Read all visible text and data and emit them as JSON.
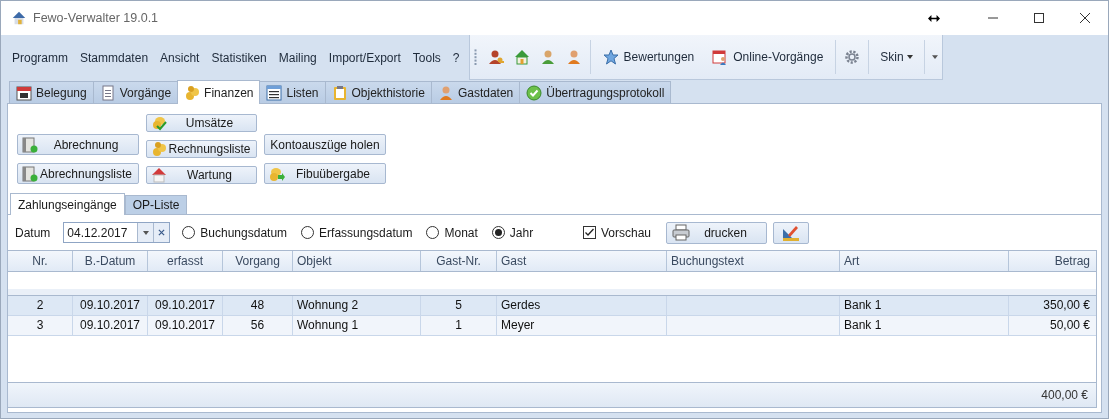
{
  "window": {
    "title": "Fewo-Verwalter 19.0.1"
  },
  "menu": [
    "Programm",
    "Stammdaten",
    "Ansicht",
    "Statistiken",
    "Mailing",
    "Import/Export",
    "Tools",
    "?"
  ],
  "toolbar": [
    {
      "kind": "icon"
    },
    {
      "kind": "icon"
    },
    {
      "kind": "icon"
    },
    {
      "kind": "icon"
    },
    {
      "kind": "button",
      "label": "Bewertungen"
    },
    {
      "kind": "button",
      "label": "Online-Vorgänge"
    },
    {
      "kind": "icon"
    },
    {
      "kind": "dropdown",
      "label": "Skin"
    }
  ],
  "module_tabs": [
    {
      "label": "Belegung",
      "selected": false
    },
    {
      "label": "Vorgänge",
      "selected": false
    },
    {
      "label": "Finanzen",
      "selected": true
    },
    {
      "label": "Listen",
      "selected": false
    },
    {
      "label": "Objekthistorie",
      "selected": false
    },
    {
      "label": "Gastdaten",
      "selected": false
    },
    {
      "label": "Übertragungsprotokoll",
      "selected": false
    }
  ],
  "action_columns": [
    [
      "Abrechnung",
      "Abrechnungsliste"
    ],
    [
      "Umsätze",
      "Rechnungsliste",
      "Wartung"
    ],
    [
      "Kontoauszüge holen",
      "Fibuübergabe"
    ]
  ],
  "sub_tabs": [
    {
      "label": "Zahlungseingänge",
      "selected": true
    },
    {
      "label": "OP-Liste",
      "selected": false
    }
  ],
  "filter": {
    "date_label": "Datum",
    "date_value": "04.12.2017",
    "radios": [
      {
        "label": "Buchungsdatum",
        "selected": false
      },
      {
        "label": "Erfassungsdatum",
        "selected": false
      },
      {
        "label": "Monat",
        "selected": false
      },
      {
        "label": "Jahr",
        "selected": true
      }
    ],
    "preview": {
      "label": "Vorschau",
      "checked": true
    },
    "print_button": "drucken"
  },
  "table": {
    "columns": [
      {
        "label": "Nr."
      },
      {
        "label": "B.-Datum"
      },
      {
        "label": "erfasst"
      },
      {
        "label": "Vorgang"
      },
      {
        "label": "Objekt"
      },
      {
        "label": "Gast-Nr."
      },
      {
        "label": "Gast"
      },
      {
        "label": "Buchungstext"
      },
      {
        "label": "Art"
      },
      {
        "label": "Betrag"
      }
    ],
    "rows": [
      {
        "selected": true,
        "cells": [
          "2",
          "09.10.2017",
          "09.10.2017",
          "48",
          "Wohnung 2",
          "5",
          "Gerdes",
          "",
          "Bank 1",
          "350,00 €"
        ]
      },
      {
        "selected": false,
        "cells": [
          "3",
          "09.10.2017",
          "09.10.2017",
          "56",
          "Wohnung 1",
          "1",
          "Meyer",
          "",
          "Bank 1",
          "50,00 €"
        ]
      }
    ],
    "total": "400,00 €"
  }
}
